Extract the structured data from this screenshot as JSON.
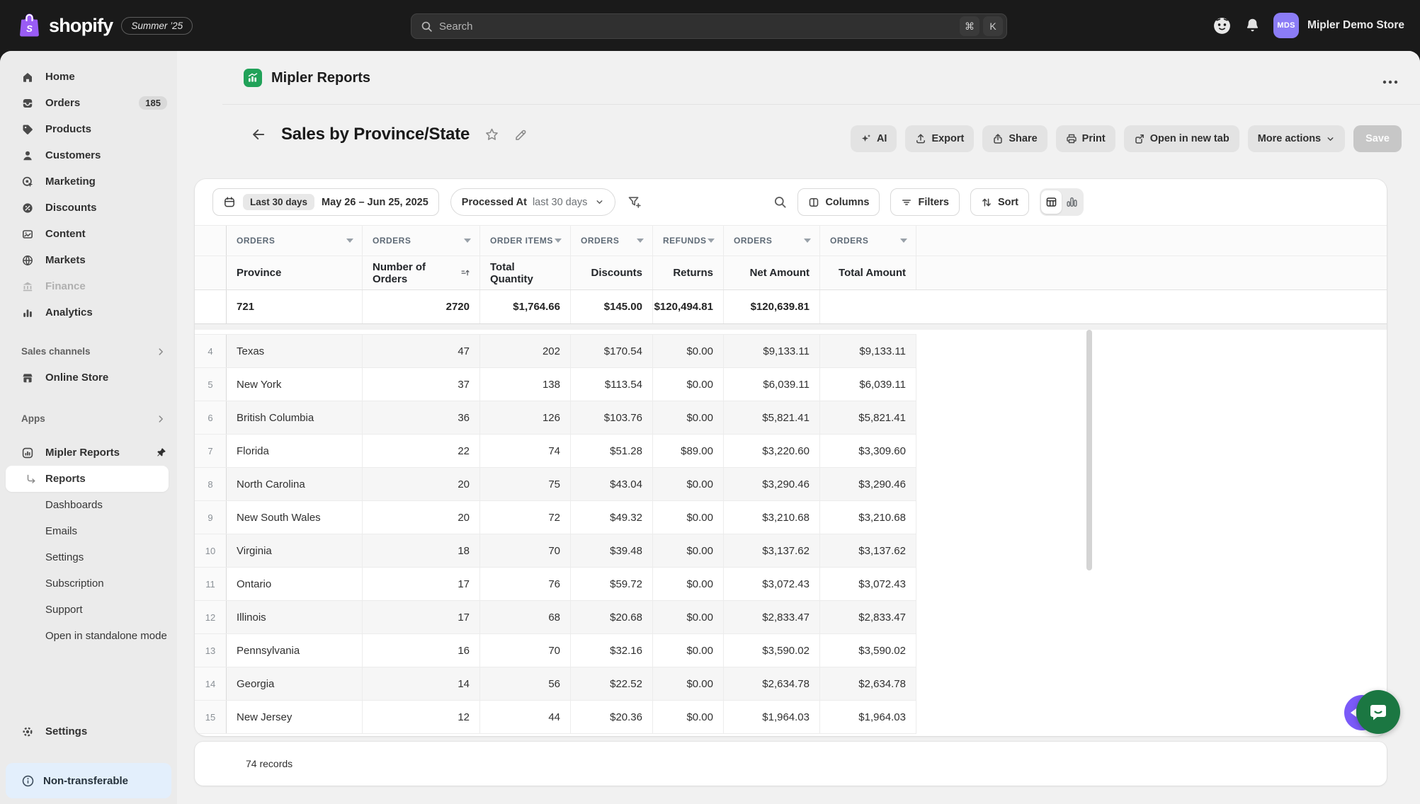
{
  "topbar": {
    "logo_text": "shopify",
    "version_badge": "Summer ’25",
    "search_placeholder": "Search",
    "kbd_cmd": "⌘",
    "kbd_k": "K",
    "store_initials": "MDS",
    "store_name": "Mipler Demo Store"
  },
  "sidebar": {
    "items": [
      {
        "label": "Home"
      },
      {
        "label": "Orders",
        "badge": "185"
      },
      {
        "label": "Products"
      },
      {
        "label": "Customers"
      },
      {
        "label": "Marketing"
      },
      {
        "label": "Discounts"
      },
      {
        "label": "Content"
      },
      {
        "label": "Markets"
      },
      {
        "label": "Finance",
        "disabled": true
      },
      {
        "label": "Analytics"
      }
    ],
    "sections": {
      "sales_channels": "Sales channels",
      "apps": "Apps"
    },
    "online_store": "Online Store",
    "app_item": "Mipler Reports",
    "app_subitems": [
      {
        "label": "Reports",
        "active": true
      },
      {
        "label": "Dashboards"
      },
      {
        "label": "Emails"
      },
      {
        "label": "Settings"
      },
      {
        "label": "Subscription"
      },
      {
        "label": "Support"
      },
      {
        "label": "Open in standalone mode"
      }
    ],
    "settings": "Settings",
    "banner": "Non-transferable"
  },
  "main": {
    "app_title": "Mipler Reports",
    "report_title": "Sales by Province/State",
    "actions": {
      "ai": "AI",
      "export": "Export",
      "share": "Share",
      "print": "Print",
      "open_new_tab": "Open in new tab",
      "more": "More actions",
      "save": "Save"
    },
    "toolbar": {
      "date_preset": "Last 30 days",
      "date_range": "May 26 – Jun 25, 2025",
      "processed_field": "Processed At",
      "processed_value": "last 30 days",
      "columns": "Columns",
      "filters": "Filters",
      "sort": "Sort"
    },
    "footer": "74 records"
  },
  "table": {
    "columns": [
      {
        "group": "ORDERS",
        "label": "Province",
        "align": "left"
      },
      {
        "group": "ORDERS",
        "label": "Number of Orders",
        "align": "right",
        "sorted": true
      },
      {
        "group": "ORDER ITEMS",
        "label": "Total Quantity",
        "align": "right"
      },
      {
        "group": "ORDERS",
        "label": "Discounts",
        "align": "right"
      },
      {
        "group": "REFUNDS",
        "label": "Returns",
        "align": "right"
      },
      {
        "group": "ORDERS",
        "label": "Net Amount",
        "align": "right"
      },
      {
        "group": "ORDERS",
        "label": "Total Amount",
        "align": "right"
      }
    ],
    "summary": [
      "",
      "721",
      "2720",
      "$1,764.66",
      "$145.00",
      "$120,494.81",
      "$120,639.81"
    ],
    "rows": [
      {
        "rank": "4",
        "cells": [
          "Texas",
          "47",
          "202",
          "$170.54",
          "$0.00",
          "$9,133.11",
          "$9,133.11"
        ]
      },
      {
        "rank": "5",
        "cells": [
          "New York",
          "37",
          "138",
          "$113.54",
          "$0.00",
          "$6,039.11",
          "$6,039.11"
        ]
      },
      {
        "rank": "6",
        "cells": [
          "British Columbia",
          "36",
          "126",
          "$103.76",
          "$0.00",
          "$5,821.41",
          "$5,821.41"
        ]
      },
      {
        "rank": "7",
        "cells": [
          "Florida",
          "22",
          "74",
          "$51.28",
          "$89.00",
          "$3,220.60",
          "$3,309.60"
        ]
      },
      {
        "rank": "8",
        "cells": [
          "North Carolina",
          "20",
          "75",
          "$43.04",
          "$0.00",
          "$3,290.46",
          "$3,290.46"
        ]
      },
      {
        "rank": "9",
        "cells": [
          "New South Wales",
          "20",
          "72",
          "$49.32",
          "$0.00",
          "$3,210.68",
          "$3,210.68"
        ]
      },
      {
        "rank": "10",
        "cells": [
          "Virginia",
          "18",
          "70",
          "$39.48",
          "$0.00",
          "$3,137.62",
          "$3,137.62"
        ]
      },
      {
        "rank": "11",
        "cells": [
          "Ontario",
          "17",
          "76",
          "$59.72",
          "$0.00",
          "$3,072.43",
          "$3,072.43"
        ]
      },
      {
        "rank": "12",
        "cells": [
          "Illinois",
          "17",
          "68",
          "$20.68",
          "$0.00",
          "$2,833.47",
          "$2,833.47"
        ]
      },
      {
        "rank": "13",
        "cells": [
          "Pennsylvania",
          "16",
          "70",
          "$32.16",
          "$0.00",
          "$3,590.02",
          "$3,590.02"
        ]
      },
      {
        "rank": "14",
        "cells": [
          "Georgia",
          "14",
          "56",
          "$22.52",
          "$0.00",
          "$2,634.78",
          "$2,634.78"
        ]
      },
      {
        "rank": "15",
        "cells": [
          "New Jersey",
          "12",
          "44",
          "$20.36",
          "$0.00",
          "$1,964.03",
          "$1,964.03"
        ]
      }
    ]
  },
  "colors": {
    "topbar": "#1a1a1a",
    "sidebar_bg": "#ebebeb",
    "main_bg": "#f1f1f1",
    "app_icon_green": "#21a259",
    "avatar_purple": "#8b7cf6",
    "banner_blue": "#e3effc",
    "chat_green": "#1b7742",
    "chat_purple": "#7a5af8"
  }
}
